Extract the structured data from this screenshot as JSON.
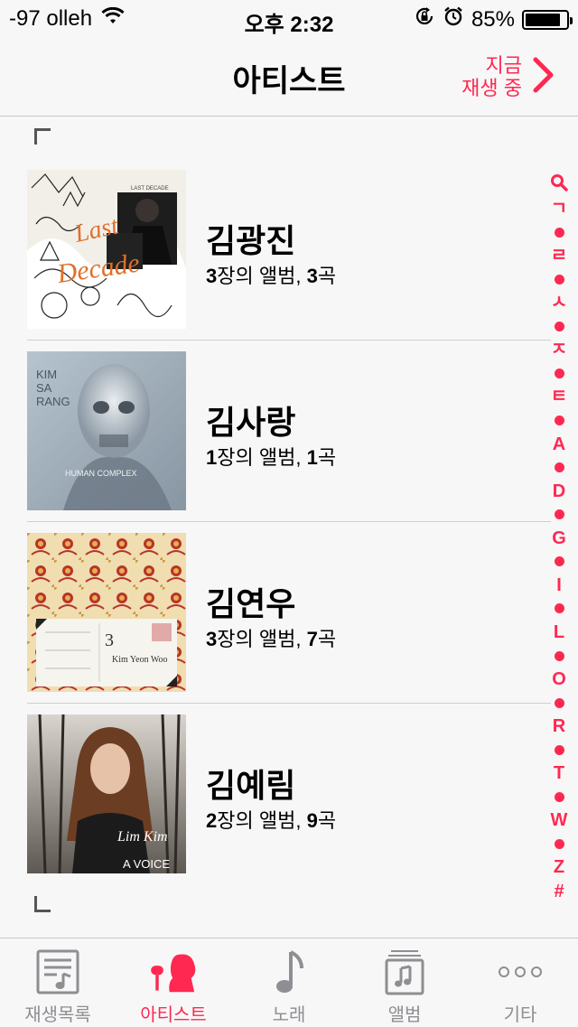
{
  "status": {
    "carrier": "-97 olleh",
    "time": "오후 2:32",
    "battery": "85%"
  },
  "nav": {
    "title": "아티스트",
    "now_playing_line1": "지금",
    "now_playing_line2": "재생 중"
  },
  "artists": [
    {
      "name": "김광진",
      "albums": "3",
      "album_label": "장의 앨범, ",
      "songs": "3",
      "song_label": "곡"
    },
    {
      "name": "김사랑",
      "albums": "1",
      "album_label": "장의 앨범, ",
      "songs": "1",
      "song_label": "곡"
    },
    {
      "name": "김연우",
      "albums": "3",
      "album_label": "장의 앨범, ",
      "songs": "7",
      "song_label": "곡"
    },
    {
      "name": "김예림",
      "albums": "2",
      "album_label": "장의 앨범, ",
      "songs": "9",
      "song_label": "곡"
    }
  ],
  "album_art_text": {
    "art1": "LAST DECADE",
    "art2_line1": "KIM",
    "art2_line2": "SA",
    "art2_line3": "RANG",
    "art2_bottom": "HUMAN COMPLEX",
    "art3_number": "3",
    "art3_name": "Kim Yeon Woo",
    "art4_name": "Lim Kim",
    "art4_sub": "A VOICE"
  },
  "index_letters": [
    "ㄱ",
    "ㄹ",
    "ㅅ",
    "ㅈ",
    "ㅌ",
    "A",
    "D",
    "G",
    "I",
    "L",
    "O",
    "R",
    "T",
    "W",
    "Z",
    "#"
  ],
  "tabs": [
    {
      "label": "재생목록",
      "icon": "playlist-icon",
      "active": false
    },
    {
      "label": "아티스트",
      "icon": "artist-icon",
      "active": true
    },
    {
      "label": "노래",
      "icon": "note-icon",
      "active": false
    },
    {
      "label": "앨범",
      "icon": "album-icon",
      "active": false
    },
    {
      "label": "기타",
      "icon": "more-icon",
      "active": false
    }
  ],
  "colors": {
    "accent": "#fe2851",
    "inactive": "#8e8e93"
  }
}
